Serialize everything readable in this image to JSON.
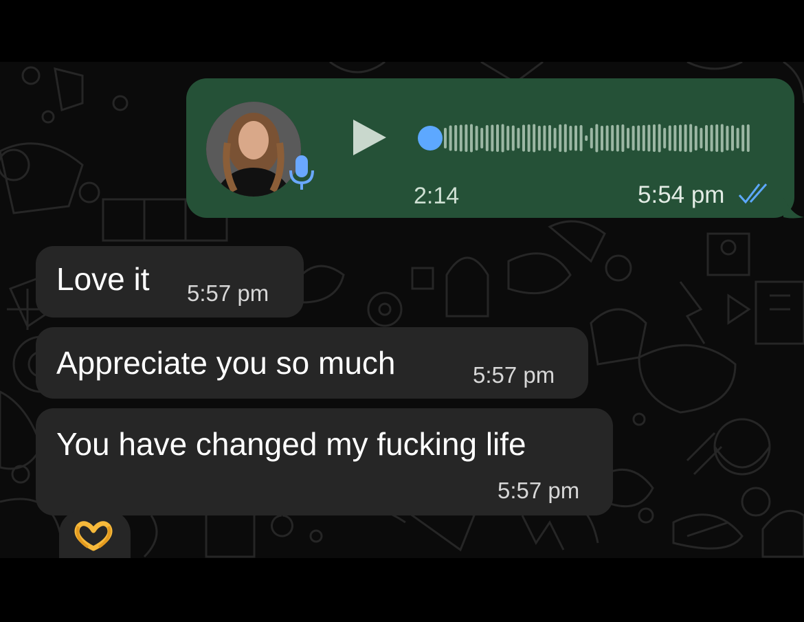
{
  "voice_message": {
    "duration": "2:14",
    "time": "5:54 pm",
    "status_icon": "double-check-icon",
    "play_icon": "play-icon",
    "mic_icon": "microphone-icon",
    "progress": 0,
    "accent_color": "#5da8ff"
  },
  "messages": [
    {
      "text": "Love it",
      "time": "5:57 pm"
    },
    {
      "text": "Appreciate you so much",
      "time": "5:57 pm"
    },
    {
      "text": "You have changed my fucking life",
      "time": "5:57 pm"
    }
  ],
  "reaction": {
    "emoji": "heart-hands",
    "icon": "heart-hands-icon"
  },
  "colors": {
    "outgoing_bubble": "#255137",
    "incoming_bubble": "#262626",
    "background": "#0b0b0b"
  }
}
